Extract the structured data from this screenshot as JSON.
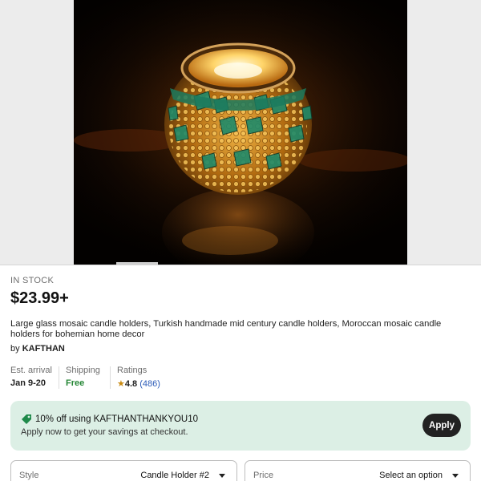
{
  "gallery": {
    "image_alt_icon": "mosaic-candle-holder-photo"
  },
  "listing": {
    "stock_status": "IN STOCK",
    "price": "$23.99+",
    "title": "Large glass mosaic candle holders, Turkish handmade mid century candle holders, Moroccan mosaic candle holders for bohemian home decor",
    "seller_prefix": "by",
    "seller_name": "KAFTHAN"
  },
  "meta": {
    "arrival_label": "Est. arrival",
    "arrival_value": "Jan 9-20",
    "shipping_label": "Shipping",
    "shipping_value": "Free",
    "ratings_label": "Ratings",
    "rating_star": "★",
    "rating_value": "4.8",
    "rating_count": "(486)"
  },
  "promo": {
    "headline": "10% off using KAFTHANTHANKYOU10",
    "subtext": "Apply now to get your savings at checkout.",
    "button_label": "Apply",
    "icon": "tag-icon"
  },
  "selectors": {
    "style_label": "Style",
    "style_value": "Candle Holder #2",
    "price_label": "Price",
    "price_value": "Select an option"
  },
  "colors": {
    "promo_bg": "#dcefe5",
    "free_green": "#258635",
    "star_gold": "#c98a10",
    "link_blue": "#2b5bb8",
    "button_dark": "#222222"
  }
}
